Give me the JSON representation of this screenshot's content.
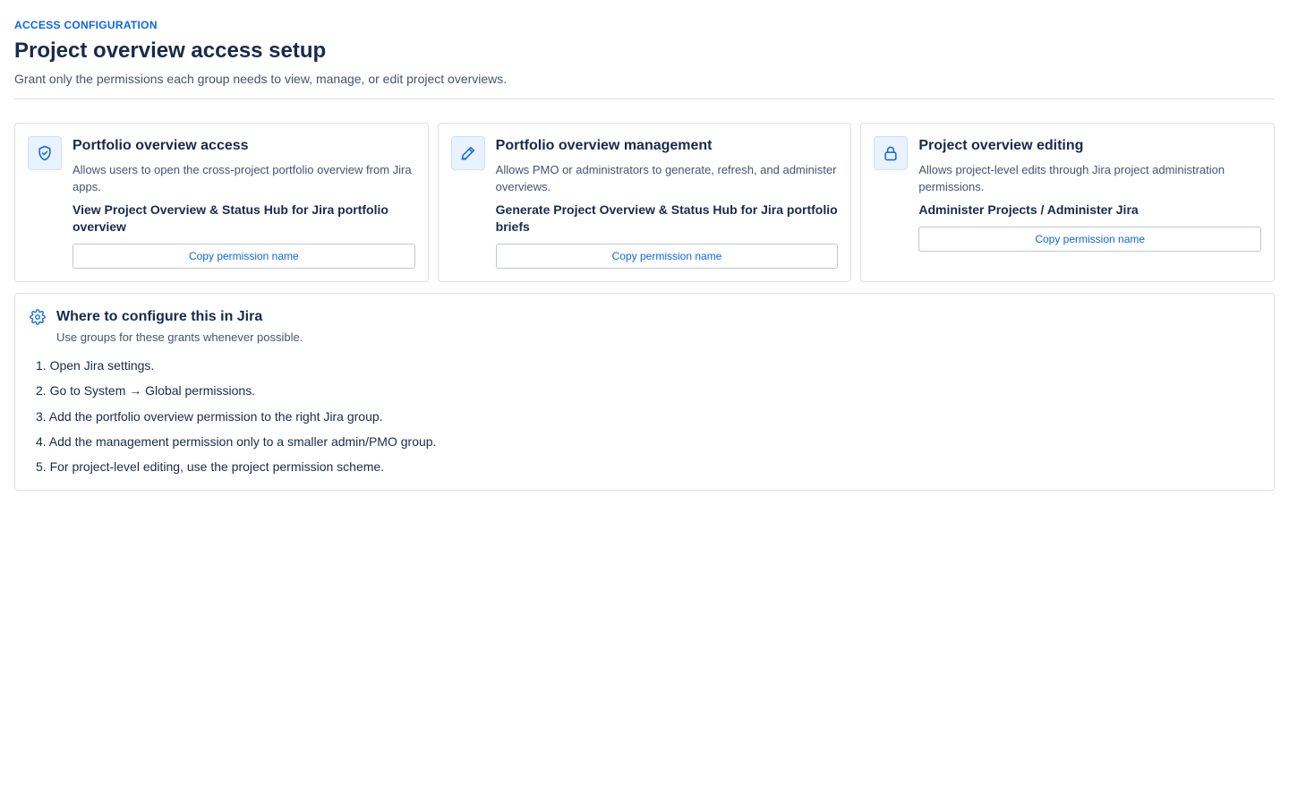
{
  "header": {
    "eyebrow": "ACCESS CONFIGURATION",
    "title": "Project overview access setup",
    "subtitle": "Grant only the permissions each group needs to view, manage, or edit project overviews."
  },
  "cards": [
    {
      "icon": "shield-check-icon",
      "title": "Portfolio overview access",
      "description": "Allows users to open the cross-project portfolio overview from Jira apps.",
      "permission": "View Project Overview & Status Hub for Jira portfolio overview",
      "button": "Copy permission name"
    },
    {
      "icon": "pencil-icon",
      "title": "Portfolio overview management",
      "description": "Allows PMO or administrators to generate, refresh, and administer overviews.",
      "permission": "Generate Project Overview & Status Hub for Jira portfolio briefs",
      "button": "Copy permission name"
    },
    {
      "icon": "lock-icon",
      "title": "Project overview editing",
      "description": "Allows project-level edits through Jira project administration permissions.",
      "permission": "Administer Projects / Administer Jira",
      "button": "Copy permission name"
    }
  ],
  "config": {
    "icon": "gear-icon",
    "title": "Where to configure this in Jira",
    "subtitle": "Use groups for these grants whenever possible.",
    "steps": [
      "1. Open Jira settings.",
      "2. Go to System → Global permissions.",
      "3. Add the portfolio overview permission to the right Jira group.",
      "4. Add the management permission only to a smaller admin/PMO group.",
      "5. For project-level editing, use the project permission scheme."
    ]
  },
  "colors": {
    "accent": "#0c66e4",
    "text": "#172b4d",
    "muted": "#44546f",
    "border": "#dcdfe4",
    "icon_bg": "#e9f2ff"
  }
}
